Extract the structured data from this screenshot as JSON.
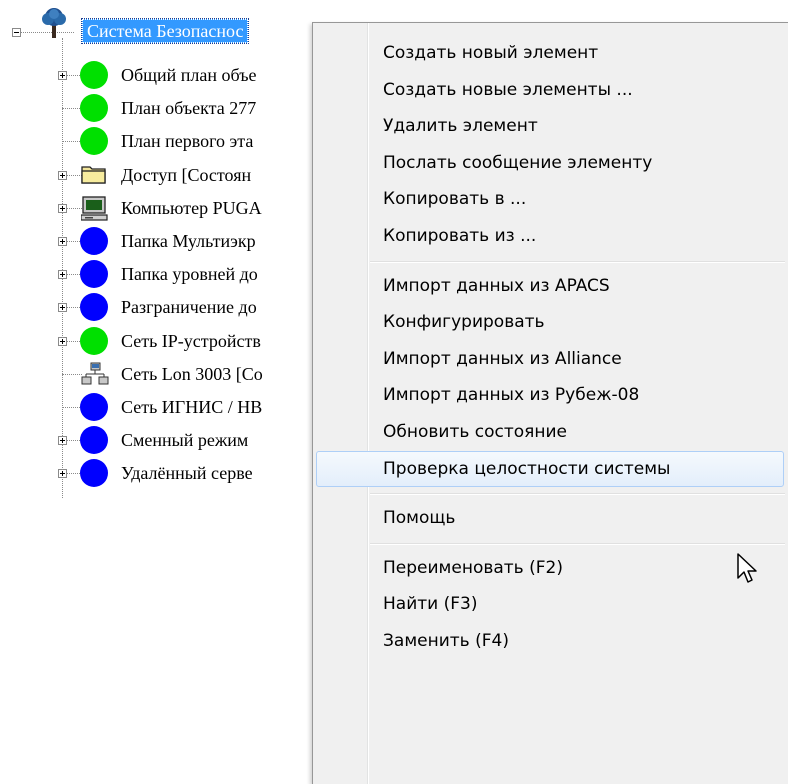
{
  "tree": {
    "root": {
      "label": "Система Безопаснос",
      "icon": "tree-root-icon"
    },
    "children": [
      {
        "label": "Общий план объе",
        "icon": "green-status-icon",
        "expandable": true
      },
      {
        "label": "План объекта 277",
        "icon": "green-status-icon",
        "expandable": false
      },
      {
        "label": "План первого эта",
        "icon": "green-status-icon",
        "expandable": false
      },
      {
        "label": "Доступ [Состоян",
        "icon": "folder-icon",
        "expandable": true
      },
      {
        "label": "Компьютер PUGA",
        "icon": "computer-icon",
        "expandable": true
      },
      {
        "label": "Папка Мультиэкр",
        "icon": "blue-status-icon",
        "expandable": true
      },
      {
        "label": "Папка уровней до",
        "icon": "blue-status-icon",
        "expandable": true
      },
      {
        "label": "Разграничение до",
        "icon": "blue-status-icon",
        "expandable": true
      },
      {
        "label": "Сеть IP-устройств",
        "icon": "green-status-icon",
        "expandable": true
      },
      {
        "label": "Сеть Lon 3003 [Co",
        "icon": "network-icon",
        "expandable": false
      },
      {
        "label": "Сеть ИГНИС / НВ",
        "icon": "blue-status-icon",
        "expandable": false
      },
      {
        "label": "Сменный режим",
        "icon": "blue-status-icon",
        "expandable": true
      },
      {
        "label": "Удалённый серве",
        "icon": "blue-status-icon",
        "expandable": true
      }
    ]
  },
  "context_menu": {
    "groups": [
      [
        "Создать новый элемент",
        "Создать новые элементы ...",
        "Удалить элемент",
        "Послать сообщение элементу",
        "Копировать в ...",
        "Копировать из ..."
      ],
      [
        "Импорт данных из APACS",
        "Конфигурировать",
        "Импорт данных из Alliance",
        "Импорт данных из Рубеж-08",
        "Обновить состояние",
        "Проверка целостности системы"
      ],
      [
        "Помощь"
      ],
      [
        "Переименовать (F2)",
        "Найти (F3)",
        "Заменить (F4)"
      ]
    ],
    "highlighted_item": "Проверка целостности системы"
  },
  "colors": {
    "selection": "#3399ff",
    "status_green": "#00e000",
    "status_blue": "#0000ff",
    "menu_bg": "#f0f0f0",
    "menu_hover_border": "#aecff7"
  }
}
